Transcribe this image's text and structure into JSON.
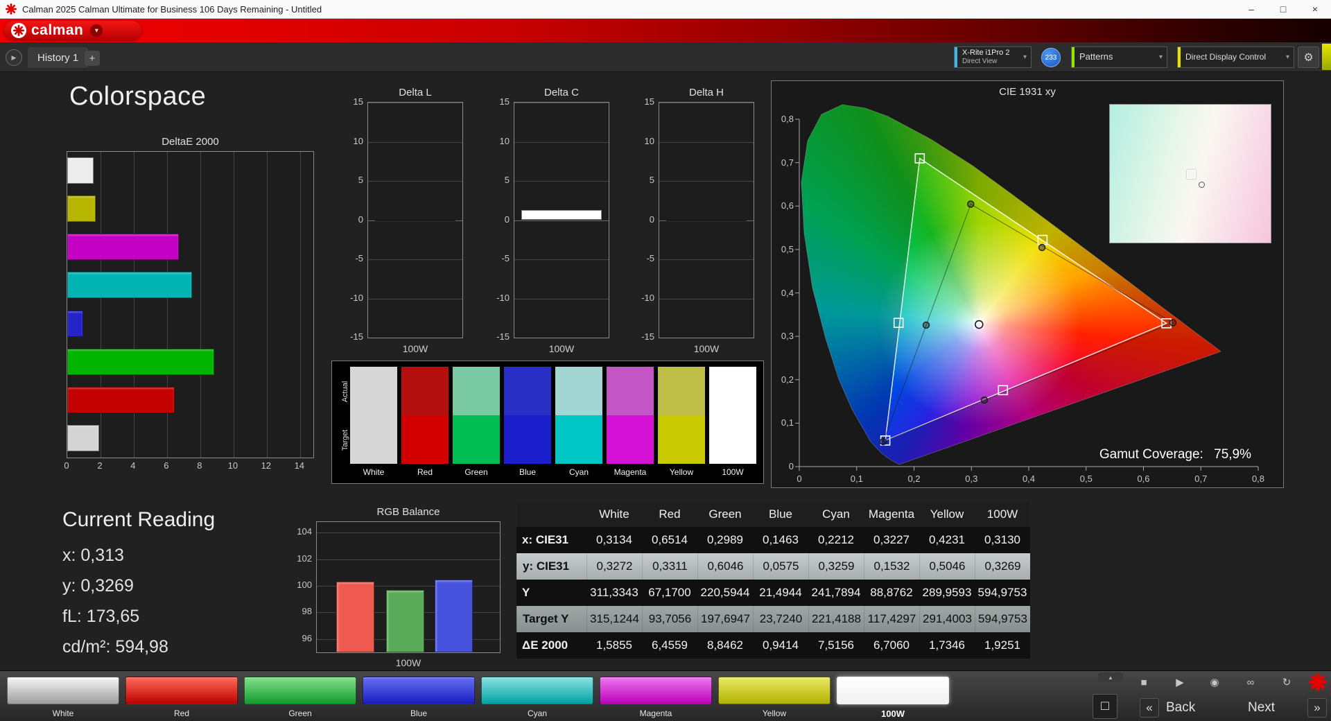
{
  "window": {
    "title": "Calman 2025 Calman Ultimate for Business 106 Days Remaining  - Untitled"
  },
  "icons": {
    "minimize": "–",
    "maximize": "□",
    "close": "×",
    "chevron": "▾",
    "gear": "⚙",
    "plus": "+",
    "tab_arrow": "▶",
    "stop": "■",
    "play": "▶",
    "camera": "◉",
    "link": "∞",
    "refresh": "↻",
    "square": "□",
    "up": "▲",
    "back_chev": "«",
    "next_chev": "»"
  },
  "brand": {
    "logo_text": "calman",
    "accent": "#e60000"
  },
  "tabs": {
    "active": "History 1"
  },
  "toolbar": {
    "meter_line1": "X-Rite i1Pro 2",
    "meter_line2": "Direct View",
    "meter_accent": "#3db7e8",
    "meter_badge": "233",
    "patterns_label": "Patterns",
    "patterns_accent": "#8ce600",
    "display_control_label": "Direct Display Control",
    "display_control_accent": "#e6e600"
  },
  "page_title": "Colorspace",
  "current_reading": {
    "title": "Current Reading",
    "lines": [
      "x: 0,313",
      "y: 0,3269",
      "fL: 173,65",
      "cd/m²: 594,98"
    ]
  },
  "swatches": {
    "row_labels": [
      "Actual",
      "Target"
    ],
    "columns": [
      {
        "label": "White",
        "actual": "#d6d6d6",
        "target": "#d6d6d6"
      },
      {
        "label": "Red",
        "actual": "#b51010",
        "target": "#d40000"
      },
      {
        "label": "Green",
        "actual": "#79c9a4",
        "target": "#00bd54"
      },
      {
        "label": "Blue",
        "actual": "#2a2fc4",
        "target": "#1a1ecb"
      },
      {
        "label": "Cyan",
        "actual": "#a3d6d2",
        "target": "#00c6c6"
      },
      {
        "label": "Magenta",
        "actual": "#c455c4",
        "target": "#d611d6"
      },
      {
        "label": "Yellow",
        "actual": "#bdbd48",
        "target": "#c9c900"
      },
      {
        "label": "100W",
        "actual": "#ffffff",
        "target": "#ffffff"
      }
    ]
  },
  "results_table": {
    "headers": [
      "White",
      "Red",
      "Green",
      "Blue",
      "Cyan",
      "Magenta",
      "Yellow",
      "100W"
    ],
    "rows": [
      {
        "label": "x: CIE31",
        "values": [
          "0,3134",
          "0,6514",
          "0,2989",
          "0,1463",
          "0,2212",
          "0,3227",
          "0,4231",
          "0,3130"
        ]
      },
      {
        "label": "y: CIE31",
        "values": [
          "0,3272",
          "0,3311",
          "0,6046",
          "0,0575",
          "0,3259",
          "0,1532",
          "0,5046",
          "0,3269"
        ]
      },
      {
        "label": "Y",
        "values": [
          "311,3343",
          "67,1700",
          "220,5944",
          "21,4944",
          "241,7894",
          "88,8762",
          "289,9593",
          "594,9753"
        ]
      },
      {
        "label": "Target Y",
        "values": [
          "315,1244",
          "93,7056",
          "197,6947",
          "23,7240",
          "221,4188",
          "117,4297",
          "291,4003",
          "594,9753"
        ]
      },
      {
        "label": "ΔE 2000",
        "values": [
          "1,5855",
          "6,4559",
          "8,8462",
          "0,9414",
          "7,5156",
          "6,7060",
          "1,7346",
          "1,9251"
        ]
      }
    ]
  },
  "chart_data": [
    {
      "id": "deltae2000",
      "type": "bar",
      "orientation": "horizontal",
      "title": "DeltaE 2000",
      "categories": [
        "White",
        "Yellow",
        "Magenta",
        "Cyan",
        "Blue",
        "Green",
        "Red",
        "100W"
      ],
      "values": [
        1.59,
        1.73,
        6.71,
        7.52,
        0.94,
        8.85,
        6.46,
        1.93
      ],
      "colors": [
        "#ececec",
        "#b6b600",
        "#c400c4",
        "#00b4b4",
        "#2424c8",
        "#00b400",
        "#c40000",
        "#d4d4d4"
      ],
      "xlim": [
        0,
        14.8
      ],
      "xticks": [
        0,
        2,
        4,
        6,
        8,
        10,
        12,
        14
      ],
      "grid": true
    },
    {
      "id": "delta_l",
      "type": "bar",
      "title": "Delta L",
      "categories": [
        "100W"
      ],
      "values": [
        0
      ],
      "ylim": [
        -15,
        15
      ],
      "yticks": [
        15,
        10,
        5,
        0,
        -5,
        -10,
        -15
      ],
      "xlabel": "100W",
      "bar_color": "#ffffff"
    },
    {
      "id": "delta_c",
      "type": "bar",
      "title": "Delta C",
      "categories": [
        "100W"
      ],
      "values": [
        1.3
      ],
      "ylim": [
        -15,
        15
      ],
      "yticks": [
        15,
        10,
        5,
        0,
        -5,
        -10,
        -15
      ],
      "xlabel": "100W",
      "bar_color": "#ffffff"
    },
    {
      "id": "delta_h",
      "type": "bar",
      "title": "Delta H",
      "categories": [
        "100W"
      ],
      "values": [
        0
      ],
      "ylim": [
        -15,
        15
      ],
      "yticks": [
        15,
        10,
        5,
        0,
        -5,
        -10,
        -15
      ],
      "xlabel": "100W",
      "bar_color": "#ffffff"
    },
    {
      "id": "rgb_balance",
      "type": "bar",
      "title": "RGB Balance",
      "categories": [
        "Red",
        "Green",
        "Blue"
      ],
      "values": [
        100.3,
        99.7,
        100.5
      ],
      "colors": [
        "#ef5a50",
        "#5aab5a",
        "#4853dd"
      ],
      "ylim": [
        95,
        104.8
      ],
      "yticks": [
        104,
        102,
        100,
        98,
        96
      ],
      "xlabel": "100W",
      "grid": true
    },
    {
      "id": "cie1931",
      "type": "scatter",
      "title": "CIE 1931 xy",
      "xlim": [
        0,
        0.8
      ],
      "ylim": [
        0,
        0.8
      ],
      "xticks": [
        0,
        0.1,
        0.2,
        0.3,
        0.4,
        0.5,
        0.6,
        0.7,
        0.8
      ],
      "xtick_labels": [
        "0",
        "0,1",
        "0,2",
        "0,3",
        "0,4",
        "0,5",
        "0,6",
        "0,7",
        "0,8"
      ],
      "yticks": [
        0,
        0.1,
        0.2,
        0.3,
        0.4,
        0.5,
        0.6,
        0.7,
        0.8
      ],
      "ytick_labels": [
        "0",
        "0,1",
        "0,2",
        "0,3",
        "0,4",
        "0,5",
        "0,6",
        "0,7",
        "0,8"
      ],
      "annotation": {
        "label": "Gamut Coverage:",
        "value": "75,9%"
      },
      "gamut_triangle_vertices": [
        "Red",
        "Green",
        "Blue"
      ],
      "series": [
        {
          "name": "target",
          "marker": "square",
          "points": [
            {
              "label": "White",
              "x": 0.3127,
              "y": 0.329
            },
            {
              "label": "Red",
              "x": 0.64,
              "y": 0.33
            },
            {
              "label": "Green",
              "x": 0.21,
              "y": 0.71
            },
            {
              "label": "Blue",
              "x": 0.15,
              "y": 0.06
            },
            {
              "label": "Cyan",
              "x": 0.173,
              "y": 0.331
            },
            {
              "label": "Magenta",
              "x": 0.355,
              "y": 0.176
            },
            {
              "label": "Yellow",
              "x": 0.424,
              "y": 0.522
            }
          ]
        },
        {
          "name": "measured",
          "marker": "circle",
          "points": [
            {
              "label": "White",
              "x": 0.3134,
              "y": 0.3272
            },
            {
              "label": "Red",
              "x": 0.6514,
              "y": 0.3311
            },
            {
              "label": "Green",
              "x": 0.2989,
              "y": 0.6046
            },
            {
              "label": "Blue",
              "x": 0.1463,
              "y": 0.0575
            },
            {
              "label": "Cyan",
              "x": 0.2212,
              "y": 0.3259
            },
            {
              "label": "Magenta",
              "x": 0.3227,
              "y": 0.1532
            },
            {
              "label": "Yellow",
              "x": 0.4231,
              "y": 0.5046
            }
          ]
        }
      ]
    }
  ],
  "footer": {
    "patterns": [
      {
        "label": "White",
        "top": "#f7f7f7",
        "bottom": "#9c9c9c",
        "selected": false
      },
      {
        "label": "Red",
        "top": "#ff6a58",
        "bottom": "#bd0000",
        "selected": false
      },
      {
        "label": "Green",
        "top": "#84e08c",
        "bottom": "#109c2e",
        "selected": false
      },
      {
        "label": "Blue",
        "top": "#6470f2",
        "bottom": "#181cbe",
        "selected": false
      },
      {
        "label": "Cyan",
        "top": "#8ae2e2",
        "bottom": "#00a2a2",
        "selected": false
      },
      {
        "label": "Magenta",
        "top": "#ee78ee",
        "bottom": "#ba00ba",
        "selected": false
      },
      {
        "label": "Yellow",
        "top": "#eaea66",
        "bottom": "#b2b200",
        "selected": false
      },
      {
        "label": "100W",
        "top": "#ffffff",
        "bottom": "#f2f2f2",
        "selected": true
      }
    ],
    "back_label": "Back",
    "next_label": "Next"
  }
}
